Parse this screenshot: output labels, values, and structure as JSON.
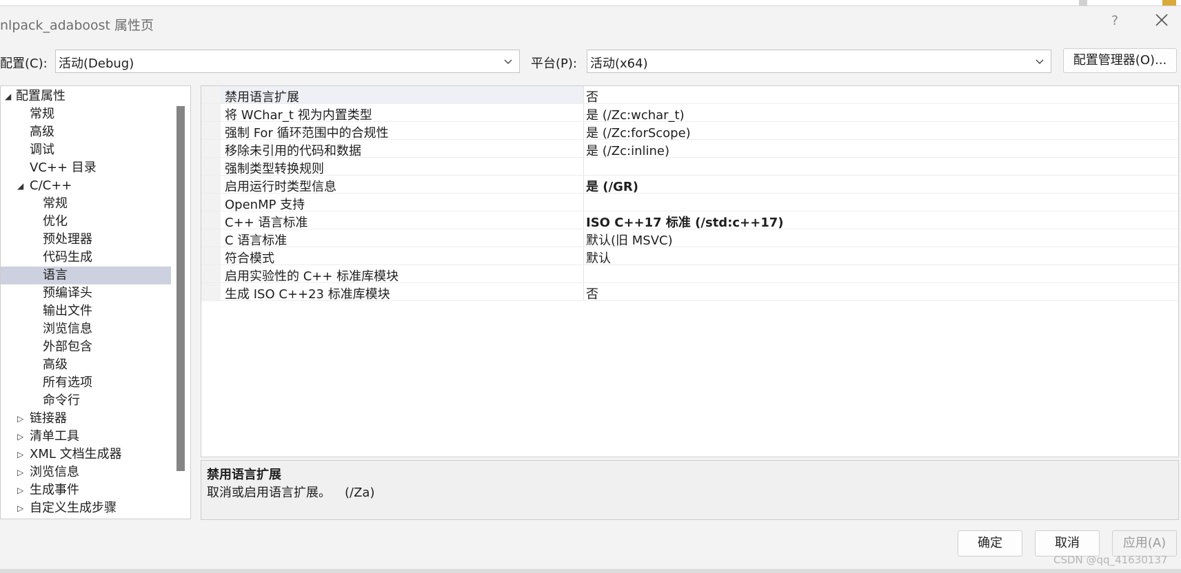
{
  "window": {
    "title": "nlpack_adaboost 属性页",
    "help_glyph": "?"
  },
  "config_bar": {
    "config_label": "配置(C):",
    "config_value": "活动(Debug)",
    "platform_label": "平台(P):",
    "platform_value": "活动(x64)",
    "manager_button": "配置管理器(O)..."
  },
  "tree": {
    "items": [
      {
        "label": "配置属性",
        "expander": "◢"
      },
      {
        "label": "常规"
      },
      {
        "label": "高级"
      },
      {
        "label": "调试"
      },
      {
        "label": "VC++ 目录"
      },
      {
        "label": "C/C++",
        "expander": "◢"
      },
      {
        "label": "常规"
      },
      {
        "label": "优化"
      },
      {
        "label": "预处理器"
      },
      {
        "label": "代码生成"
      },
      {
        "label": "语言",
        "selected": true
      },
      {
        "label": "预编译头"
      },
      {
        "label": "输出文件"
      },
      {
        "label": "浏览信息"
      },
      {
        "label": "外部包含"
      },
      {
        "label": "高级"
      },
      {
        "label": "所有选项"
      },
      {
        "label": "命令行"
      },
      {
        "label": "链接器",
        "expander": "▷"
      },
      {
        "label": "清单工具",
        "expander": "▷"
      },
      {
        "label": "XML 文档生成器",
        "expander": "▷"
      },
      {
        "label": "浏览信息",
        "expander": "▷"
      },
      {
        "label": "生成事件",
        "expander": "▷"
      },
      {
        "label": "自定义生成步骤",
        "expander": "▷"
      }
    ]
  },
  "properties": {
    "rows": [
      {
        "name": "禁用语言扩展",
        "value": "否"
      },
      {
        "name": "将 WChar_t 视为内置类型",
        "value": "是 (/Zc:wchar_t)"
      },
      {
        "name": "强制 For 循环范围中的合规性",
        "value": "是 (/Zc:forScope)"
      },
      {
        "name": "移除未引用的代码和数据",
        "value": "是 (/Zc:inline)"
      },
      {
        "name": "强制类型转换规则",
        "value": ""
      },
      {
        "name": "启用运行时类型信息",
        "value": "是 (/GR)",
        "bold": true
      },
      {
        "name": "OpenMP 支持",
        "value": ""
      },
      {
        "name": "C++ 语言标准",
        "value": "ISO C++17 标准 (/std:c++17)",
        "bold": true
      },
      {
        "name": "C 语言标准",
        "value": "默认(旧 MSVC)"
      },
      {
        "name": "符合模式",
        "value": "默认"
      },
      {
        "name": "启用实验性的 C++ 标准库模块",
        "value": ""
      },
      {
        "name": "生成 ISO C++23 标准库模块",
        "value": "否"
      }
    ]
  },
  "description": {
    "title": "禁用语言扩展",
    "text": "取消或启用语言扩展。",
    "flag": "(/Za)"
  },
  "buttons": {
    "ok": "确定",
    "cancel": "取消",
    "apply": "应用(A)"
  },
  "watermark": "CSDN @qq_41630137",
  "colors": {
    "selection": "#cdd0de",
    "dialog_bg": "#f3f3f3",
    "disabled_text": "#9a9a9a"
  }
}
